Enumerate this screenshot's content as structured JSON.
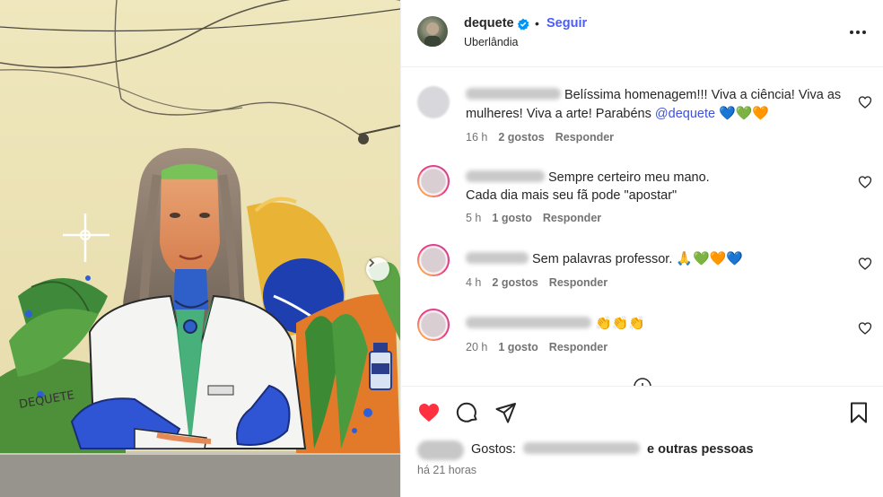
{
  "post": {
    "username": "dequete",
    "verified": true,
    "separator": "•",
    "follow_label": "Seguir",
    "location": "Uberlândia"
  },
  "comments": [
    {
      "text": "Belíssima homenagem!!! Viva a ciência! Viva as mulheres! Viva a arte! Parabéns",
      "mention": "@dequete",
      "emoji": "💙💚🧡",
      "time": "16 h",
      "likes": "2 gostos",
      "reply": "Responder"
    },
    {
      "text_line1": "Sempre certeiro meu mano.",
      "text_line2": "Cada dia mais seu fã pode \"apostar\"",
      "time": "5 h",
      "likes": "1 gosto",
      "reply": "Responder"
    },
    {
      "text": "Sem palavras professor.",
      "emoji": "🙏💚🧡💙",
      "time": "4 h",
      "likes": "2 gostos",
      "reply": "Responder"
    },
    {
      "emoji": "👏👏👏",
      "time": "20 h",
      "likes": "1 gosto",
      "reply": "Responder"
    }
  ],
  "likes_summary": {
    "prefix": "Gostos:",
    "suffix": "e outras pessoas"
  },
  "posted_ago": "há 21 horas",
  "icons": {
    "like": "heart-filled-icon",
    "comment": "comment-icon",
    "share": "send-icon",
    "save": "bookmark-icon",
    "more": "more-options-icon",
    "verified": "verified-badge-icon",
    "carousel_next": "chevron-right-icon"
  },
  "colors": {
    "like_red": "#ff3040",
    "link_blue": "#4a5df9",
    "verified_blue": "#0095f6",
    "muted_text": "#737373"
  }
}
